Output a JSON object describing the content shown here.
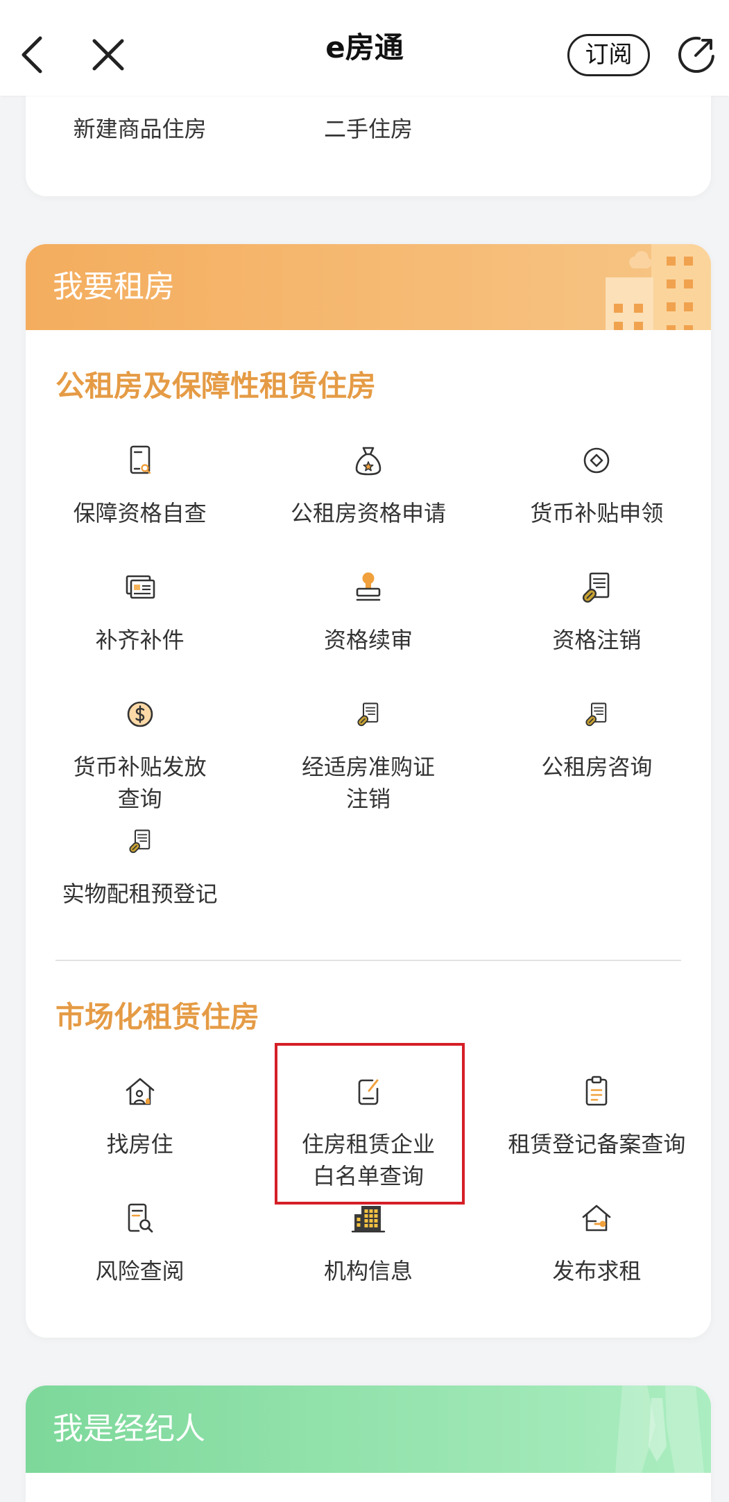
{
  "header": {
    "title": "e房通",
    "subscribe_label": "订阅",
    "icons": {
      "back": "back-chevron-icon",
      "close": "close-icon",
      "share": "share-icon"
    }
  },
  "previous_card": {
    "items": [
      {
        "label": "新建商品住房"
      },
      {
        "label": "二手住房"
      }
    ]
  },
  "rent_card": {
    "title": "我要租房",
    "sections": [
      {
        "title": "公租房及保障性租赁住房",
        "items": [
          {
            "label": "保障资格自查",
            "icon": "document-search-icon"
          },
          {
            "label": "公租房资格申请",
            "icon": "money-bag-star-icon"
          },
          {
            "label": "货币补贴申领",
            "icon": "coin-diamond-icon"
          },
          {
            "label": "补齐补件",
            "icon": "id-cards-icon"
          },
          {
            "label": "资格续审",
            "icon": "stamp-icon"
          },
          {
            "label": "资格注销",
            "icon": "document-clip-icon"
          },
          {
            "label": "货币补贴发放\n查询",
            "icon": "dollar-coin-icon"
          },
          {
            "label": "经适房准购证\n注销",
            "icon": "document-clip-small-icon"
          },
          {
            "label": "公租房咨询",
            "icon": "document-clip-small-icon"
          },
          {
            "label": "实物配租预登记",
            "icon": "document-clip-small-icon"
          }
        ]
      },
      {
        "title": "市场化租赁住房",
        "items": [
          {
            "label": "找房住",
            "icon": "house-person-icon"
          },
          {
            "label": "住房租赁企业\n白名单查询",
            "icon": "note-edit-icon",
            "highlighted": true
          },
          {
            "label": "租赁登记备案查询",
            "icon": "clipboard-icon"
          },
          {
            "label": "风险查阅",
            "icon": "document-magnifier-icon"
          },
          {
            "label": "机构信息",
            "icon": "office-building-icon"
          },
          {
            "label": "发布求租",
            "icon": "house-key-icon"
          }
        ]
      }
    ]
  },
  "agent_card": {
    "title": "我是经纪人"
  },
  "colors": {
    "accent": "#e59b45",
    "highlight": "#d51f27",
    "text": "#333333",
    "rent_band_start": "#f4ad5e",
    "rent_band_end": "#f7c585",
    "agent_band_start": "#7dd89a",
    "agent_band_end": "#abedc0"
  }
}
